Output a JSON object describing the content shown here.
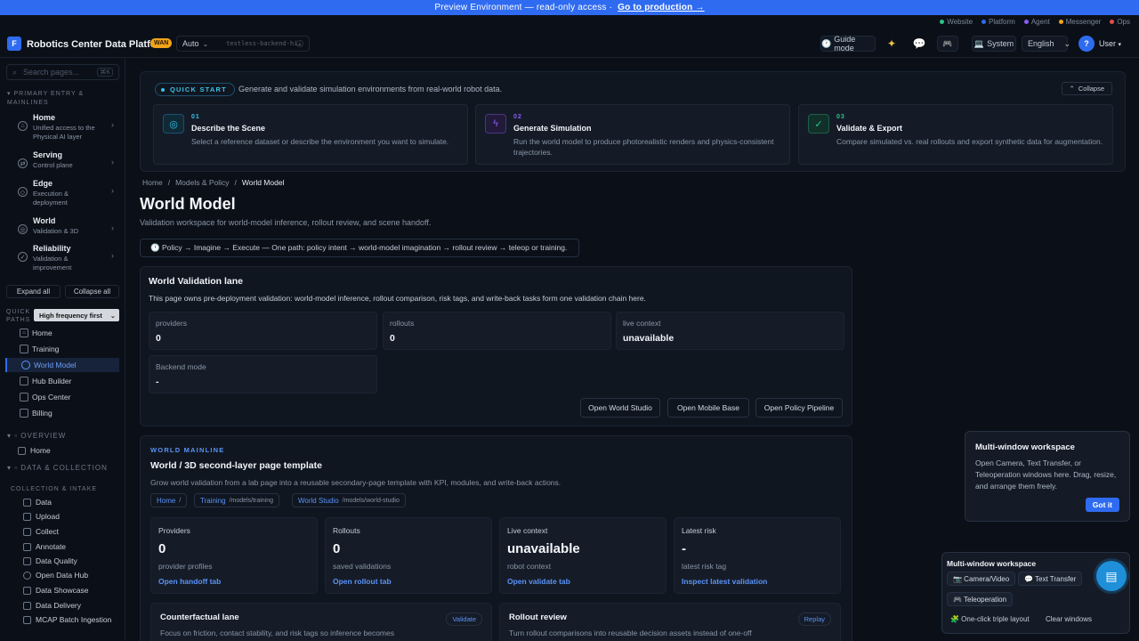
{
  "banner": {
    "text": "Preview Environment — read-only access  ·",
    "link": "Go to production →"
  },
  "ext_links": [
    {
      "label": "Website",
      "color": "#2bc48a"
    },
    {
      "label": "Platform",
      "color": "#2f6bf0"
    },
    {
      "label": "Agent",
      "color": "#8a5cf5"
    },
    {
      "label": "Messenger",
      "color": "#f0a41a"
    },
    {
      "label": "Ops",
      "color": "#e54c4c"
    }
  ],
  "topbar": {
    "app_title": "Robotics Center Data Platform",
    "wan_badge": "WAN",
    "mode": "Auto",
    "backend": "testless-backend-hi…",
    "guide_mode": "Guide mode",
    "system": "System",
    "language": "English",
    "avatar": "?",
    "user": "User"
  },
  "sidebar": {
    "search_placeholder": "Search pages...",
    "search_kbd": "⌘K",
    "section_primary": "Primary entry & mainlines",
    "main_items": [
      {
        "title": "Home",
        "sub": "Unified access to the Physical AI layer"
      },
      {
        "title": "Serving",
        "sub": "Control plane"
      },
      {
        "title": "Edge",
        "sub": "Execution & deployment"
      },
      {
        "title": "World",
        "sub": "Validation & 3D"
      },
      {
        "title": "Reliability",
        "sub": "Validation & improvement"
      }
    ],
    "expand_all": "Expand all",
    "collapse_all": "Collapse all",
    "quick_paths_label": "Quick paths",
    "quick_paths_select": "High frequency first",
    "quick_items": [
      "Home",
      "Training",
      "World Model",
      "Hub Builder",
      "Ops Center",
      "Billing"
    ],
    "overview_label": "Overview",
    "overview_item": "Home",
    "data_collection_label": "Data & Collection",
    "collection_intake_label": "Collection & Intake",
    "collection_items": [
      "Data",
      "Upload",
      "Collect",
      "Annotate",
      "Data Quality",
      "Open Data Hub",
      "Data Showcase",
      "Data Delivery",
      "MCAP Batch Ingestion"
    ]
  },
  "quickstart": {
    "badge": "QUICK START",
    "desc": "Generate and validate simulation environments from real-world robot data.",
    "collapse": "Collapse",
    "steps": [
      {
        "num": "01",
        "title": "Describe the Scene",
        "desc": "Select a reference dataset or describe the environment you want to simulate.",
        "color": "#38c2e8"
      },
      {
        "num": "02",
        "title": "Generate Simulation",
        "desc": "Run the world model to produce photorealistic renders and physics-consistent trajectories.",
        "color": "#8a5cf5"
      },
      {
        "num": "03",
        "title": "Validate & Export",
        "desc": "Compare simulated vs. real rollouts and export synthetic data for augmentation.",
        "color": "#2bc48a"
      }
    ]
  },
  "breadcrumb": {
    "home": "Home",
    "models": "Models & Policy",
    "current": "World Model"
  },
  "page": {
    "title": "World Model",
    "subtitle": "Validation workspace for world-model inference, rollout review, and scene handoff.",
    "path": "🕐 Policy → Imagine → Execute — One path: policy intent → world-model imagination → rollout review → teleop or training."
  },
  "validation_lane": {
    "title": "World Validation lane",
    "desc": "This page owns pre-deployment validation: world-model inference, rollout comparison, risk tags, and write-back tasks form one validation chain here.",
    "providers_label": "providers",
    "providers_value": "0",
    "rollouts_label": "rollouts",
    "rollouts_value": "0",
    "live_label": "live context",
    "live_value": "unavailable",
    "backend_label": "Backend mode",
    "backend_value": "-",
    "btn_studio": "Open World Studio",
    "btn_mobile": "Open Mobile Base",
    "btn_policy": "Open Policy Pipeline"
  },
  "mainline": {
    "kicker": "WORLD MAINLINE",
    "title": "World / 3D second-layer page template",
    "desc": "Grow world validation from a lab page into a reusable secondary-page template with KPI, modules, and write-back actions.",
    "chips": [
      {
        "label": "Home",
        "path": "/"
      },
      {
        "label": "Training",
        "path": "/models/training"
      },
      {
        "label": "World Studio",
        "path": "/models/world-studio"
      }
    ],
    "cards": [
      {
        "k": "Providers",
        "v": "0",
        "s": "provider profiles",
        "a": "Open handoff tab"
      },
      {
        "k": "Rollouts",
        "v": "0",
        "s": "saved validations",
        "a": "Open rollout tab"
      },
      {
        "k": "Live context",
        "v": "unavailable",
        "s": "robot context",
        "a": "Open validate tab"
      },
      {
        "k": "Latest risk",
        "v": "-",
        "s": "latest risk tag",
        "a": "Inspect latest validation"
      }
    ],
    "lanes": [
      {
        "title": "Counterfactual lane",
        "desc": "Focus on friction, contact stability, and risk tags so inference becomes",
        "badge": "Validate"
      },
      {
        "title": "Rollout review",
        "desc": "Turn rollout comparisons into reusable decision assets instead of one-off",
        "badge": "Replay"
      }
    ]
  },
  "popover": {
    "title": "Multi-window workspace",
    "desc": "Open Camera, Text Transfer, or Teleoperation windows here. Drag, resize, and arrange them freely.",
    "button": "Got it"
  },
  "dock": {
    "title": "Multi-window workspace",
    "camera": "📷 Camera/Video",
    "text_transfer": "💬 Text Transfer",
    "teleop": "🎮 Teleoperation",
    "triple": "🧩 One-click triple layout",
    "clear": "Clear windows"
  }
}
